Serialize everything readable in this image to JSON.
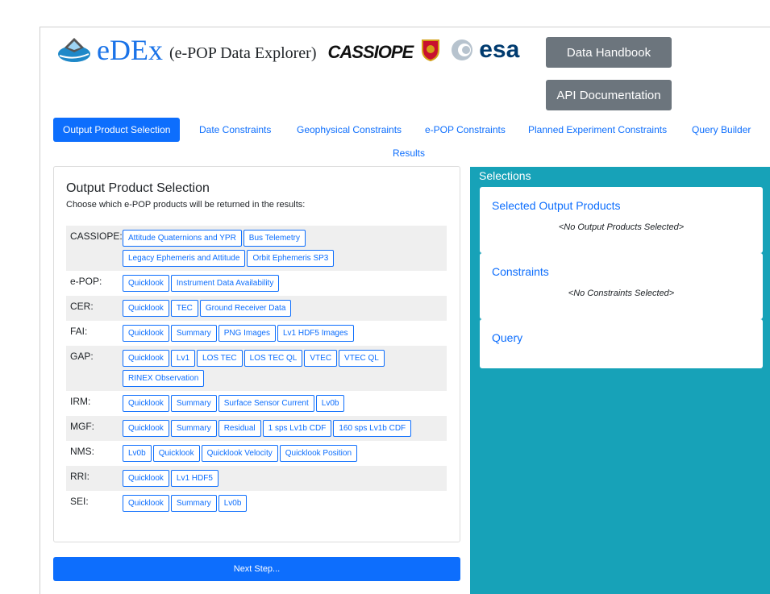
{
  "header": {
    "title": "eDEx",
    "subtitle": "(e-POP Data Explorer)",
    "partner_logo_text": "CASSIOPE",
    "esa_logo_text": "esa",
    "handbook_button": "Data Handbook",
    "api_button": "API Documentation"
  },
  "tabs": [
    {
      "label": "Output Product Selection"
    },
    {
      "label": "Date Constraints"
    },
    {
      "label": "Geophysical Constraints"
    },
    {
      "label": "e-POP Constraints"
    },
    {
      "label": "Planned Experiment Constraints"
    },
    {
      "label": "Query Builder"
    },
    {
      "label": "Results"
    }
  ],
  "output_selection": {
    "title": "Output Product Selection",
    "description": "Choose which e-POP products will be returned in the results:",
    "groups": [
      {
        "label": "CASSIOPE:",
        "items": [
          "Attitude Quaternions and YPR",
          "Bus Telemetry",
          "Legacy Ephemeris and Attitude",
          "Orbit Ephemeris SP3"
        ]
      },
      {
        "label": "e-POP:",
        "items": [
          "Quicklook",
          "Instrument Data Availability"
        ]
      },
      {
        "label": "CER:",
        "items": [
          "Quicklook",
          "TEC",
          "Ground Receiver Data"
        ]
      },
      {
        "label": "FAI:",
        "items": [
          "Quicklook",
          "Summary",
          "PNG Images",
          "Lv1 HDF5 Images"
        ]
      },
      {
        "label": "GAP:",
        "items": [
          "Quicklook",
          "Lv1",
          "LOS TEC",
          "LOS TEC QL",
          "VTEC",
          "VTEC QL",
          "RINEX Observation"
        ]
      },
      {
        "label": "IRM:",
        "items": [
          "Quicklook",
          "Summary",
          "Surface Sensor Current",
          "Lv0b"
        ]
      },
      {
        "label": "MGF:",
        "items": [
          "Quicklook",
          "Summary",
          "Residual",
          "1 sps Lv1b CDF",
          "160 sps Lv1b CDF"
        ]
      },
      {
        "label": "NMS:",
        "items": [
          "Lv0b",
          "Quicklook",
          "Quicklook Velocity",
          "Quicklook Position"
        ]
      },
      {
        "label": "RRI:",
        "items": [
          "Quicklook",
          "Lv1 HDF5"
        ]
      },
      {
        "label": "SEI:",
        "items": [
          "Quicklook",
          "Summary",
          "Lv0b"
        ]
      }
    ],
    "next_button": "Next Step..."
  },
  "selections": {
    "title": "Selections",
    "output_products_heading": "Selected Output Products",
    "output_products_empty": "<No Output Products Selected>",
    "constraints_heading": "Constraints",
    "constraints_empty": "<No Constraints Selected>",
    "query_heading": "Query"
  },
  "colors": {
    "primary": "#0d6efd",
    "secondary": "#6c757d",
    "info_panel": "#17a2b8",
    "title_blue": "#1a73e8"
  }
}
